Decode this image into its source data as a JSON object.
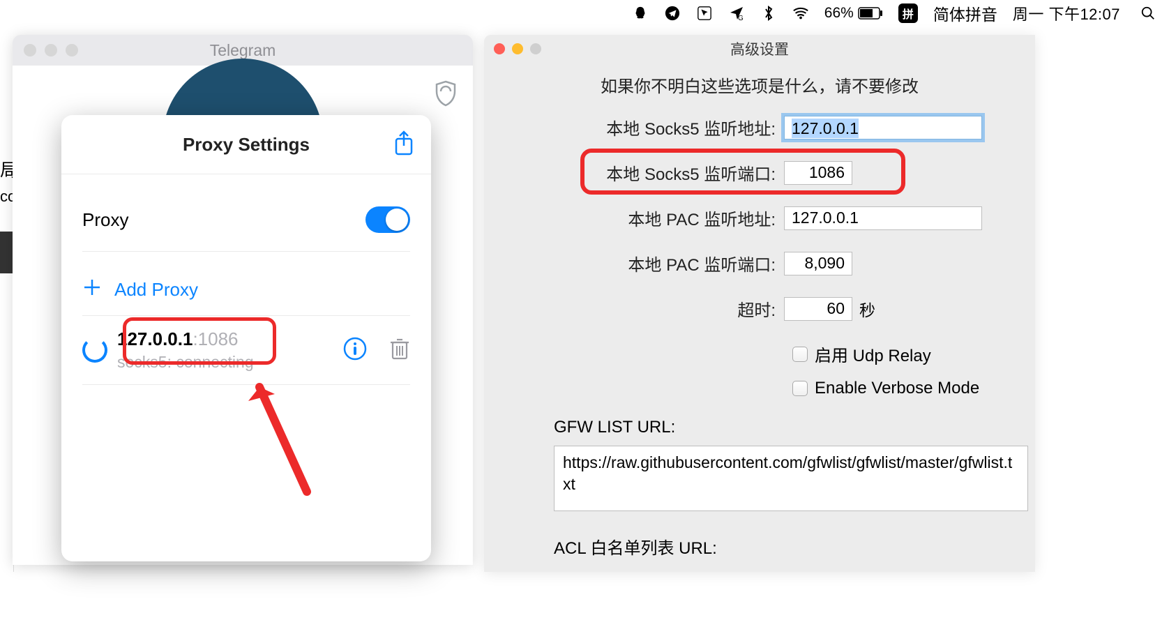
{
  "menubar": {
    "battery_percent": "66%",
    "ime_box": "拼",
    "ime_label": "简体拼音",
    "clock": "周一 下午12:07"
  },
  "telegram": {
    "title": "Telegram",
    "sidebar_line1": "局",
    "sidebar_line2": "co"
  },
  "sheet": {
    "title": "Proxy Settings",
    "proxy_label": "Proxy",
    "add_proxy": "Add Proxy",
    "entry_ip": "127.0.0.1",
    "entry_port": ":1086",
    "entry_status": "socks5: connecting"
  },
  "adv": {
    "title": "高级设置",
    "warning": "如果你不明白这些选项是什么，请不要修改",
    "socks5_addr_label": "本地 Socks5 监听地址:",
    "socks5_addr_value": "127.0.0.1",
    "socks5_port_label": "本地 Socks5 监听端口:",
    "socks5_port_value": "1086",
    "pac_addr_label": "本地 PAC 监听地址:",
    "pac_addr_value": "127.0.0.1",
    "pac_port_label": "本地 PAC 监听端口:",
    "pac_port_value": "8,090",
    "timeout_label": "超时:",
    "timeout_value": "60",
    "timeout_unit": "秒",
    "udp_label": "启用 Udp Relay",
    "verbose_label": "Enable Verbose Mode",
    "gfw_label": "GFW LIST URL:",
    "gfw_value": "https://raw.githubusercontent.com/gfwlist/gfwlist/master/gfwlist.txt",
    "acl_label": "ACL 白名单列表 URL:"
  }
}
